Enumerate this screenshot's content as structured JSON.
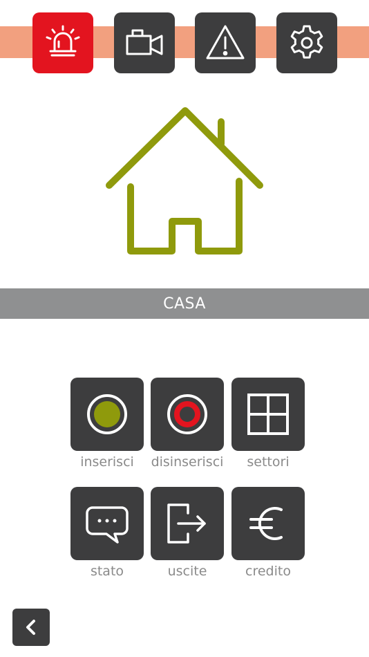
{
  "header": {
    "buttons": [
      {
        "icon": "siren-icon",
        "active": true
      },
      {
        "icon": "video-camera-icon",
        "active": false
      },
      {
        "icon": "warning-icon",
        "active": false
      },
      {
        "icon": "gear-icon",
        "active": false
      }
    ]
  },
  "main": {
    "house_icon": "house-icon",
    "title": "CASA"
  },
  "actions": [
    {
      "label": "inserisci",
      "icon": "arm-icon"
    },
    {
      "label": "disinserisci",
      "icon": "disarm-icon"
    },
    {
      "label": "settori",
      "icon": "grid-icon"
    },
    {
      "label": "stato",
      "icon": "chat-bubble-icon"
    },
    {
      "label": "uscite",
      "icon": "exit-icon"
    },
    {
      "label": "credito",
      "icon": "euro-icon"
    }
  ],
  "footer": {
    "back_icon": "chevron-left-icon"
  },
  "colors": {
    "accent_red": "#e3141f",
    "band_orange": "#f2a07f",
    "tile_dark": "#3d3d3e",
    "house_green": "#8f9a0c",
    "title_gray": "#8f9091"
  }
}
